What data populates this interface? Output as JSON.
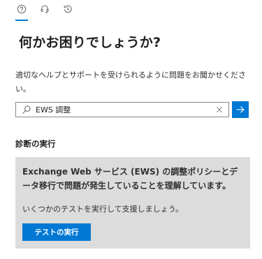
{
  "tabs": [
    {
      "icon": "help-circle-icon",
      "active": true
    },
    {
      "icon": "headset-icon",
      "active": false
    },
    {
      "icon": "history-icon",
      "active": false
    }
  ],
  "title": "何かお困りでしょうか?",
  "description": "適切なヘルプとサポートを受けられるように問題をお聞かせください。",
  "search": {
    "value": "EWS 調整",
    "icon": "search-icon",
    "clear_icon": "close-icon",
    "submit_icon": "arrow-right-icon"
  },
  "diagnostics": {
    "section_title": "診断の実行",
    "heading": "Exchange Web サービス (EWS) の調整ポリシーとデータ移行で問題が発生していることを理解しています。",
    "text": "いくつかのテストを実行して支援しましょう。",
    "button_label": "テストの実行"
  },
  "colors": {
    "accent": "#0078d4",
    "card_background": "#dcdcdc",
    "text": "#201f1e"
  }
}
